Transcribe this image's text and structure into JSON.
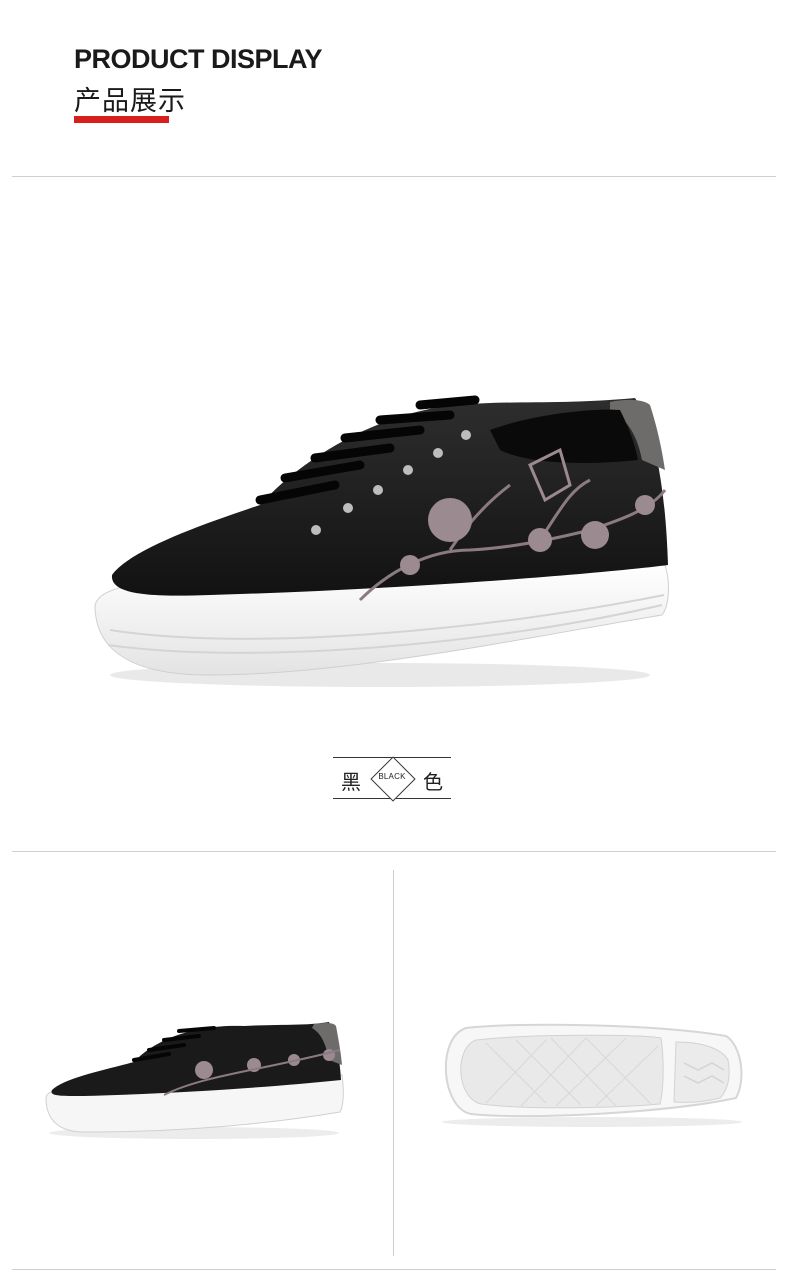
{
  "header": {
    "title_en": "PRODUCT DISPLAY",
    "title_cn": "产品展示"
  },
  "color_label": {
    "cn_left": "黑",
    "cn_right": "色",
    "en": "BLACK"
  },
  "colors": {
    "accent_red": "#d7201b",
    "divider": "#cfcfcf",
    "shoe_upper": "#1b1b1b",
    "sole": "#f2f2f2",
    "embroidery": "#8c7a82"
  }
}
